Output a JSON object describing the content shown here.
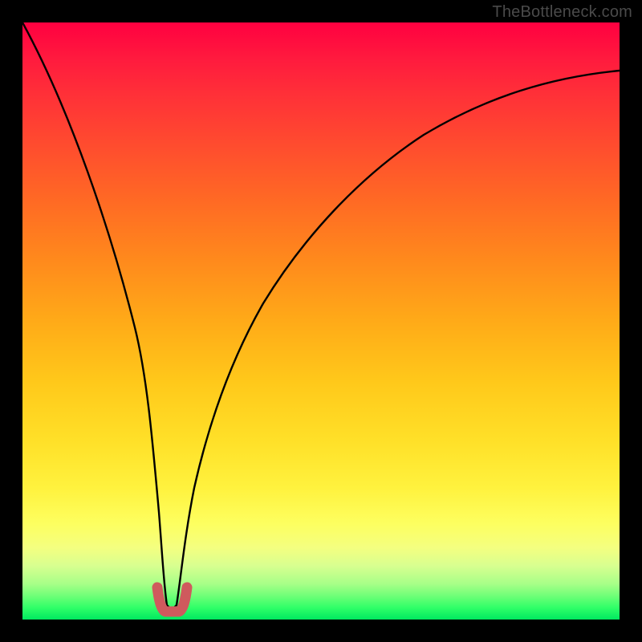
{
  "watermark": "TheBottleneck.com",
  "chart_data": {
    "type": "line",
    "title": "",
    "xlabel": "",
    "ylabel": "",
    "xlim": [
      0,
      100
    ],
    "ylim": [
      0,
      100
    ],
    "grid": false,
    "legend": false,
    "annotations": [],
    "series": [
      {
        "name": "bottleneck-curve",
        "x": [
          0,
          5,
          10,
          15,
          18,
          20,
          22,
          23,
          24,
          25,
          26,
          27,
          28,
          30,
          33,
          38,
          45,
          55,
          65,
          75,
          85,
          95,
          100
        ],
        "values": [
          100,
          88,
          74,
          56,
          42,
          30,
          15,
          7,
          3,
          2,
          3,
          7,
          14,
          26,
          39,
          53,
          64,
          74,
          80,
          84,
          87,
          89,
          90
        ]
      },
      {
        "name": "minimum-marker",
        "x": [
          22.4,
          23.0,
          23.6,
          24.3,
          25.0,
          25.7,
          26.4,
          27.0,
          27.6
        ],
        "values": [
          5.5,
          3.3,
          2.2,
          1.8,
          1.8,
          1.8,
          2.2,
          3.3,
          5.5
        ]
      }
    ],
    "colors": {
      "background_gradient_top": "#ff0040",
      "background_gradient_mid": "#ffe028",
      "background_gradient_bottom": "#00e860",
      "curve": "#000000",
      "marker": "#cf5a5d",
      "frame": "#000000"
    },
    "minimum": {
      "x": 25,
      "value": 1.8
    }
  }
}
